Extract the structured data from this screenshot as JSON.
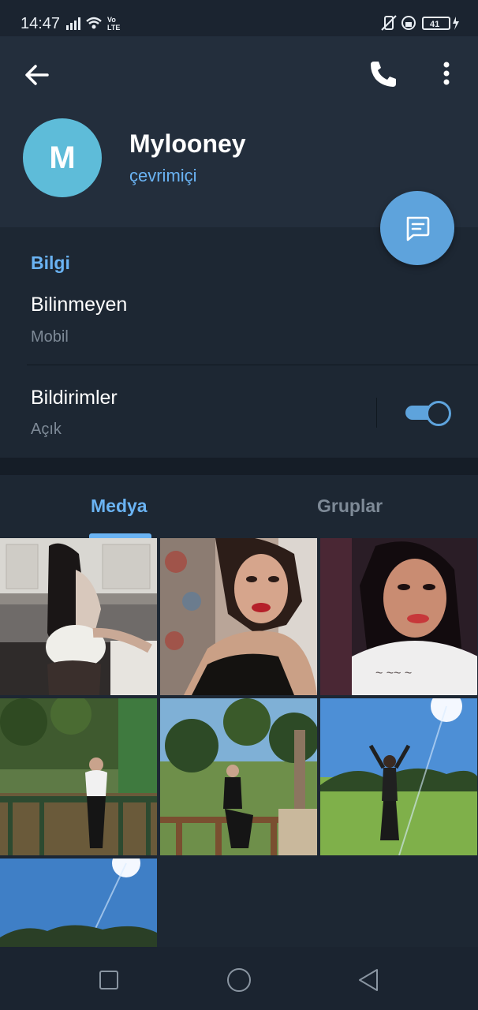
{
  "status_bar": {
    "time": "14:47",
    "network": "Vo LTE",
    "battery": "41"
  },
  "header": {
    "back_icon": "arrow-left-icon",
    "call_icon": "phone-icon",
    "more_icon": "more-vertical-icon",
    "avatar_initial": "M",
    "name": "Mylooney",
    "status": "çevrimiçi",
    "message_icon": "chat-message-icon"
  },
  "info": {
    "section_title": "Bilgi",
    "phone_title": "Bilinmeyen",
    "phone_subtitle": "Mobil",
    "notifications_title": "Bildirimler",
    "notifications_subtitle": "Açık",
    "notifications_enabled": true
  },
  "tabs": {
    "media_label": "Medya",
    "groups_label": "Gruplar",
    "active": "Medya"
  },
  "media": {
    "items": [
      {
        "kind": "photo-kitchen"
      },
      {
        "kind": "photo-selfie-bed"
      },
      {
        "kind": "photo-selfie-dark"
      },
      {
        "kind": "photo-garden-fence"
      },
      {
        "kind": "photo-park-fence"
      },
      {
        "kind": "photo-field-sky"
      },
      {
        "kind": "photo-sky-trees"
      }
    ]
  },
  "colors": {
    "accent": "#6ab3f3",
    "background": "#1d2733",
    "header": "#232e3c",
    "avatar": "#5ebcd9",
    "fab": "#5ea3dc"
  }
}
